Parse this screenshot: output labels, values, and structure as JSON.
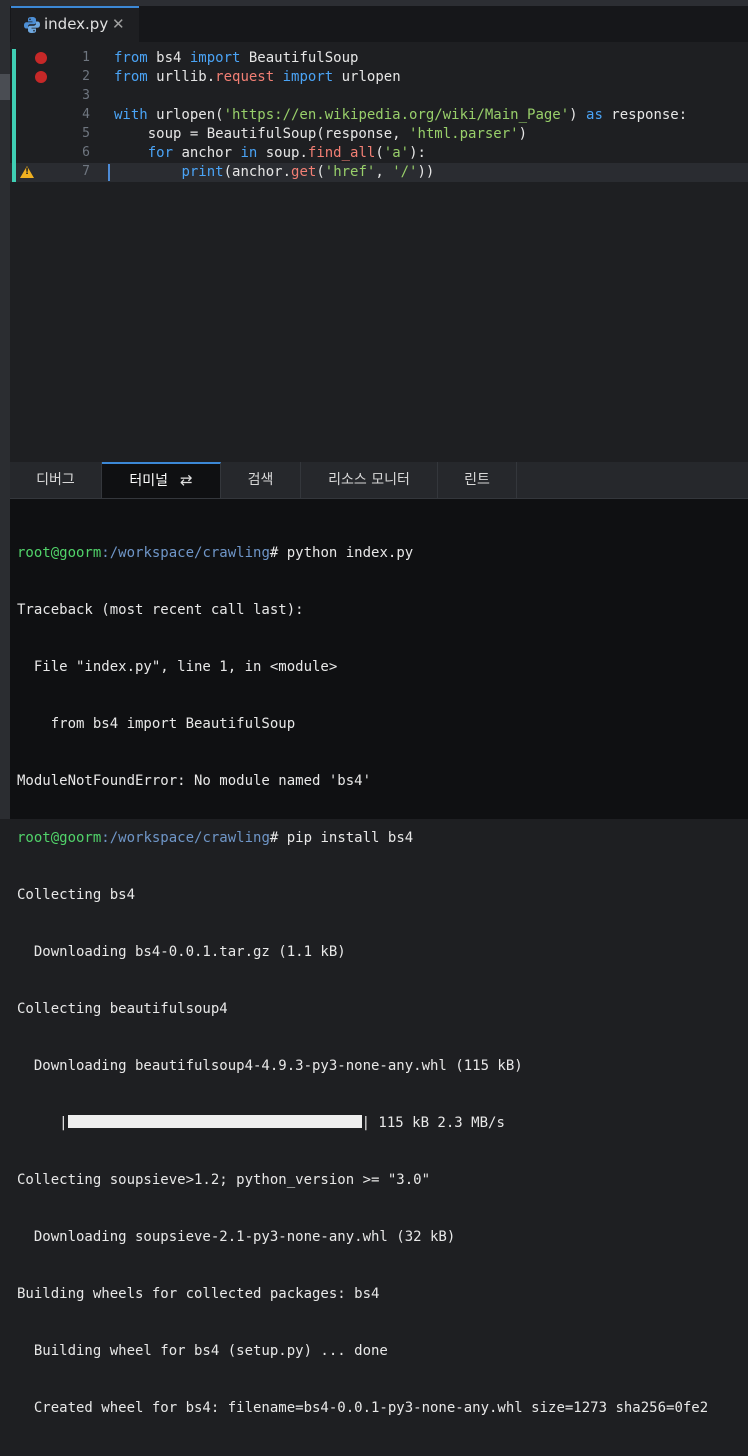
{
  "tab": {
    "title": "index.py",
    "close": "✕",
    "icon": "python-icon"
  },
  "editor": {
    "lines": [
      {
        "num": "1",
        "breakpoint": true
      },
      {
        "num": "2",
        "breakpoint": true
      },
      {
        "num": "3"
      },
      {
        "num": "4"
      },
      {
        "num": "5"
      },
      {
        "num": "6"
      },
      {
        "num": "7",
        "warning": true,
        "current": true
      }
    ],
    "code": {
      "l1": {
        "kw1": "from",
        "mod": " bs4 ",
        "kw2": "import",
        "name": " BeautifulSoup"
      },
      "l2": {
        "kw1": "from",
        "mod1": " urllib.",
        "mod2": "request",
        "kw2": " import",
        "name": " urlopen"
      },
      "l4": {
        "kw1": "with",
        "t1": " urlopen(",
        "s1": "'https://en.wikipedia.org/wiki/Main_Page'",
        "t2": ") ",
        "kw2": "as",
        "t3": " response:"
      },
      "l5": {
        "t1": "    soup = BeautifulSoup(response, ",
        "s1": "'html.parser'",
        "t2": ")"
      },
      "l6": {
        "t0": "    ",
        "kw1": "for",
        "t1": " anchor ",
        "kw2": "in",
        "t2": " soup.",
        "f1": "find_all",
        "t3": "(",
        "s1": "'a'",
        "t4": "):"
      },
      "l7": {
        "t0": "        ",
        "kw1": "print",
        "t1": "(anchor.",
        "f1": "get",
        "t2": "(",
        "s1": "'href'",
        "t3": ", ",
        "s2": "'/'",
        "t4": "))"
      }
    }
  },
  "panel": {
    "tabs": [
      {
        "label": "디버그"
      },
      {
        "label": "터미널",
        "active": true,
        "icon": "refresh-icon"
      },
      {
        "label": "검색"
      },
      {
        "label": "리소스 모니터"
      },
      {
        "label": "린트"
      }
    ]
  },
  "terminal": {
    "prompt_user": "root@goorm",
    "prompt_path": ":/workspace/crawling",
    "prompt_sign": "#",
    "cmd1": " python index.py",
    "out1": [
      "Traceback (most recent call last):",
      "  File \"index.py\", line 1, in <module>",
      "    from bs4 import BeautifulSoup",
      "ModuleNotFoundError: No module named 'bs4'"
    ],
    "cmd2": " pip install bs4",
    "out2": [
      "Collecting bs4",
      "  Downloading bs4-0.0.1.tar.gz (1.1 kB)",
      "Collecting beautifulsoup4",
      "  Downloading beautifulsoup4-4.9.3-py3-none-any.whl (115 kB)"
    ],
    "progress": {
      "prefix": "     |",
      "suffix": "| 115 kB 2.3 MB/s",
      "fraction": 1.0
    },
    "out3": [
      "Collecting soupsieve>1.2; python_version >= \"3.0\"",
      "  Downloading soupsieve-2.1-py3-none-any.whl (32 kB)",
      "Building wheels for collected packages: bs4",
      "  Building wheel for bs4 (setup.py) ... done",
      "  Created wheel for bs4: filename=bs4-0.0.1-py3-none-any.whl size=1273 sha256=0fe2"
    ]
  }
}
